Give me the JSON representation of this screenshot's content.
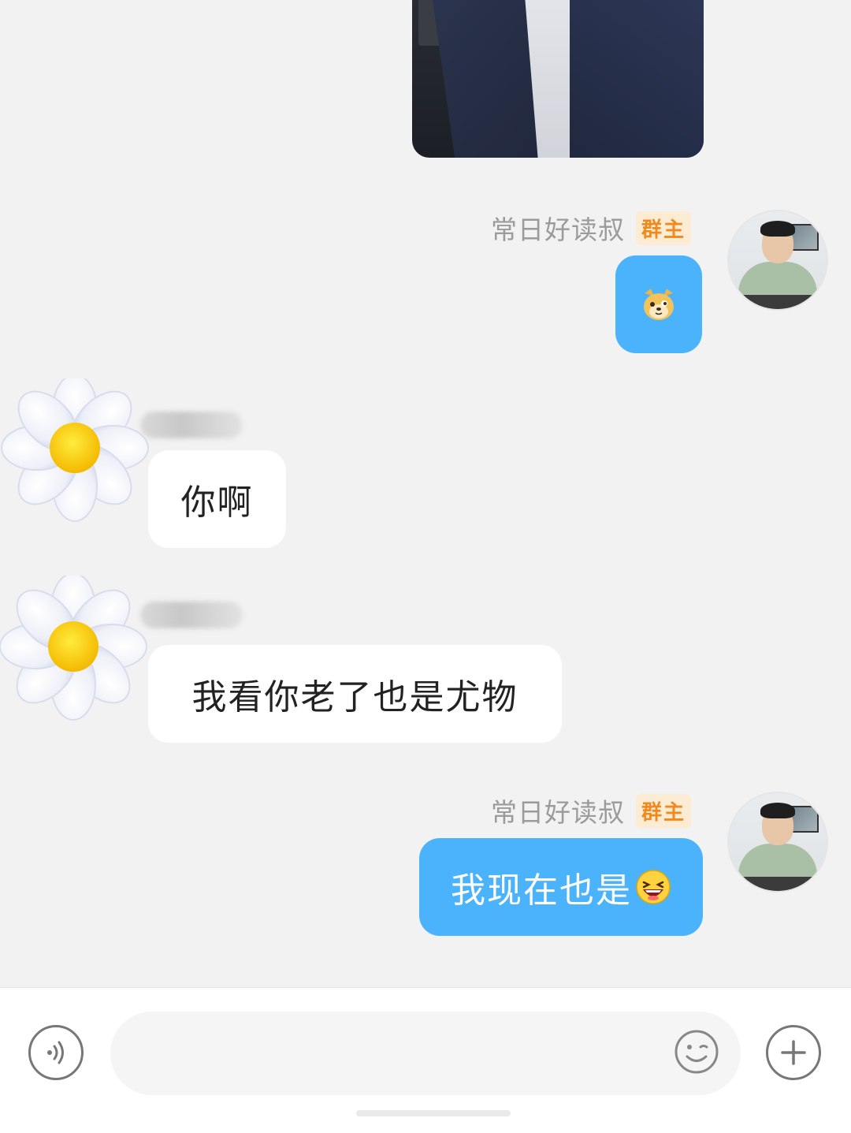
{
  "messages": {
    "self_name_1": "常日好读叔",
    "self_badge_1": "群主",
    "self_name_2": "常日好读叔",
    "self_badge_2": "群主",
    "msg_ni_a": "你啊",
    "msg_laole": "我看你老了也是尤物",
    "msg_xianzai": "我现在也是"
  },
  "icons": {
    "voice": "voice-icon",
    "emoji": "smile-icon",
    "plus": "plus-icon",
    "doge_sticker": "doge-emoji-icon",
    "grin_emoji": "laughing-emoji-icon"
  },
  "colors": {
    "self_bubble": "#4bb3fb",
    "other_bubble": "#ffffff",
    "badge_text": "#f08a1f",
    "badge_bg": "#fdecd4",
    "chat_bg": "#f2f2f2"
  }
}
